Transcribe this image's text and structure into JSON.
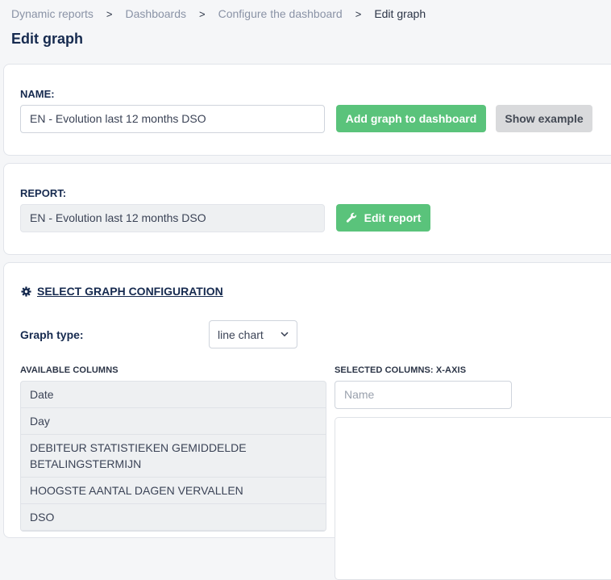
{
  "breadcrumb": [
    "Dynamic reports",
    "Dashboards",
    "Configure the dashboard",
    "Edit graph"
  ],
  "page_title": "Edit graph",
  "name_section": {
    "label": "NAME:",
    "value": "EN - Evolution last 12 months DSO",
    "add_button": "Add graph to dashboard",
    "example_button": "Show example"
  },
  "report_section": {
    "label": "REPORT:",
    "value": "EN - Evolution last 12 months DSO",
    "edit_button": "Edit report"
  },
  "config_section": {
    "title": "SELECT GRAPH CONFIGURATION",
    "graph_type_label": "Graph type:",
    "graph_type_value": "line chart",
    "available_columns_label": "AVAILABLE COLUMNS",
    "available_columns": [
      "Date",
      "Day",
      "DEBITEUR STATISTIEKEN GEMIDDELDE BETALINGSTERMIJN",
      "HOOGSTE AANTAL DAGEN VERVALLEN",
      "DSO"
    ],
    "selected_xaxis_label": "SELECTED COLUMNS: X-AXIS",
    "xaxis_placeholder": "Name"
  },
  "colors": {
    "accent_green": "#5ac37b",
    "title_navy": "#162a4f",
    "gray_button": "#d9dadc"
  }
}
